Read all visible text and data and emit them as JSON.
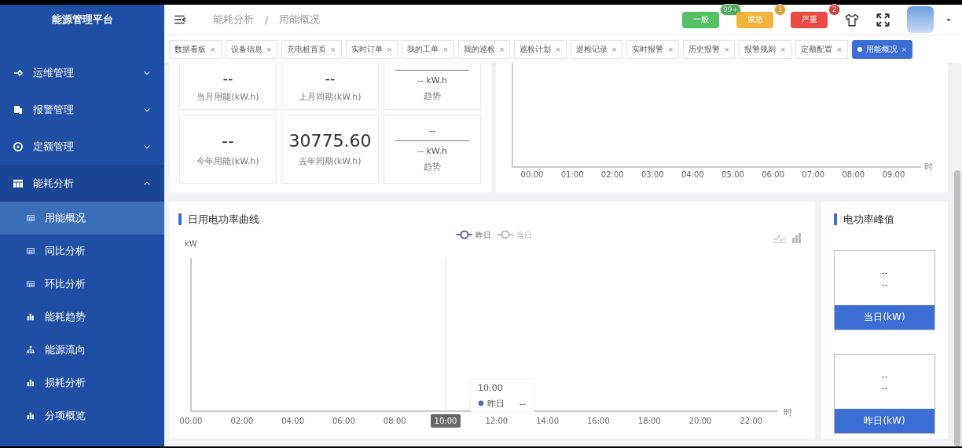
{
  "sidebar": {
    "title": "能源管理平台",
    "items": [
      {
        "label": "运维管理",
        "expanded": false
      },
      {
        "label": "报警管理",
        "expanded": false
      },
      {
        "label": "定额管理",
        "expanded": false
      },
      {
        "label": "能耗分析",
        "expanded": true,
        "children": [
          {
            "label": "用能概况",
            "kind": "table",
            "selected": true
          },
          {
            "label": "同比分析",
            "kind": "table",
            "selected": false
          },
          {
            "label": "环比分析",
            "kind": "table",
            "selected": false
          },
          {
            "label": "能耗趋势",
            "kind": "bars",
            "selected": false
          },
          {
            "label": "能源流向",
            "kind": "tree",
            "selected": false
          },
          {
            "label": "损耗分析",
            "kind": "bars",
            "selected": false
          },
          {
            "label": "分项概览",
            "kind": "bars",
            "selected": false
          }
        ]
      }
    ]
  },
  "header": {
    "breadcrumb": [
      "能耗分析",
      "用能概况"
    ],
    "separator": "/",
    "alerts": [
      {
        "label": "一般",
        "count": "99+",
        "color": "#52c063"
      },
      {
        "label": "紧急",
        "count": "1",
        "color": "#f3b43c"
      },
      {
        "label": "严重",
        "count": "2",
        "color": "#e94a43"
      }
    ]
  },
  "tabs": [
    {
      "label": "数据看板",
      "selected": false
    },
    {
      "label": "设备信息",
      "selected": false
    },
    {
      "label": "充电桩首页",
      "selected": false
    },
    {
      "label": "实时订单",
      "selected": false
    },
    {
      "label": "我的工单",
      "selected": false
    },
    {
      "label": "我的巡检",
      "selected": false
    },
    {
      "label": "巡检计划",
      "selected": false
    },
    {
      "label": "巡检记录",
      "selected": false
    },
    {
      "label": "实时报警",
      "selected": false
    },
    {
      "label": "历史报警",
      "selected": false
    },
    {
      "label": "报警规则",
      "selected": false
    },
    {
      "label": "定额配置",
      "selected": false
    },
    {
      "label": "用能概况",
      "selected": true
    }
  ],
  "tab_close": "×",
  "stats": [
    {
      "kind": "value",
      "value": "--",
      "label": "当月用能(kW.h)"
    },
    {
      "kind": "value",
      "value": "--",
      "label": "上月同期(kW.h)"
    },
    {
      "kind": "trend",
      "value": "-- kW.h",
      "label": "趋势"
    },
    {
      "kind": "value",
      "value": "--",
      "label": "今年用能(kW.h)"
    },
    {
      "kind": "value",
      "value": "30775.60",
      "label": "去年同期(kW.h)"
    },
    {
      "kind": "trend",
      "top": "--",
      "value": "-- kW.h",
      "label": "趋势"
    }
  ],
  "hourly_chart": {
    "x_labels": [
      "00:00",
      "01:00",
      "02:00",
      "03:00",
      "04:00",
      "05:00",
      "06:00",
      "07:00",
      "08:00",
      "09:00"
    ],
    "x_unit": "时"
  },
  "power_curve": {
    "title": "日用电功率曲线",
    "y_unit": "kW",
    "x_unit": "时",
    "legend": [
      {
        "label": "昨日",
        "selected": true
      },
      {
        "label": "当日",
        "selected": false
      }
    ],
    "x_labels": [
      {
        "label": "00:00",
        "selected": false
      },
      {
        "label": "02:00",
        "selected": false
      },
      {
        "label": "04:00",
        "selected": false
      },
      {
        "label": "06:00",
        "selected": false
      },
      {
        "label": "08:00",
        "selected": false
      },
      {
        "label": "10:00",
        "selected": true
      },
      {
        "label": "12:00",
        "selected": false
      },
      {
        "label": "14:00",
        "selected": false
      },
      {
        "label": "16:00",
        "selected": false
      },
      {
        "label": "18:00",
        "selected": false
      },
      {
        "label": "20:00",
        "selected": false
      },
      {
        "label": "22:00",
        "selected": false
      }
    ],
    "tooltip": {
      "time": "10:00",
      "series": "昨日",
      "value": "--"
    }
  },
  "peak": {
    "title": "电功率峰值",
    "cards": [
      {
        "value": "--",
        "time": "--",
        "label": "当日(kW)"
      },
      {
        "value": "--",
        "time": "--",
        "label": "昨日(kW)"
      }
    ]
  }
}
